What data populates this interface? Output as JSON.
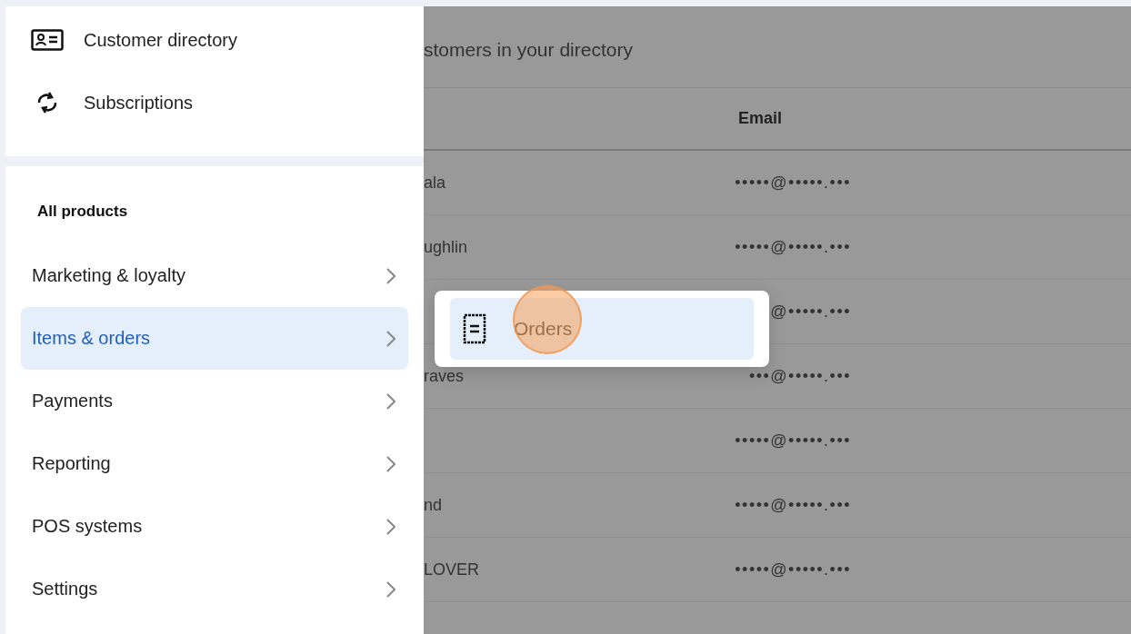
{
  "sidebar": {
    "top_items": [
      {
        "label": "Customer directory"
      },
      {
        "label": "Subscriptions"
      }
    ],
    "section_title": "All products",
    "items": [
      {
        "label": "Marketing & loyalty",
        "selected": false
      },
      {
        "label": "Items & orders",
        "selected": true
      },
      {
        "label": "Payments",
        "selected": false
      },
      {
        "label": "Reporting",
        "selected": false
      },
      {
        "label": "POS systems",
        "selected": false
      },
      {
        "label": "Settings",
        "selected": false
      }
    ]
  },
  "submenu": {
    "items": [
      {
        "label": "Orders",
        "selected": true
      }
    ]
  },
  "page": {
    "subtitle": "stomers in your directory",
    "table": {
      "columns": [
        "",
        "Email"
      ],
      "rows": [
        {
          "name": "ala",
          "email": "•••••@•••••.•••"
        },
        {
          "name": "ughlin",
          "email": "•••••@•••••.•••"
        },
        {
          "name": "",
          "email": "@•••••.•••"
        },
        {
          "name": "raves",
          "email": "•••@•••••.•••"
        },
        {
          "name": "",
          "email": "•••••@•••••.•••"
        },
        {
          "name": "nd",
          "email": "•••••@•••••.•••"
        },
        {
          "name": "LOVER",
          "email": "•••••@•••••.•••"
        }
      ]
    }
  }
}
